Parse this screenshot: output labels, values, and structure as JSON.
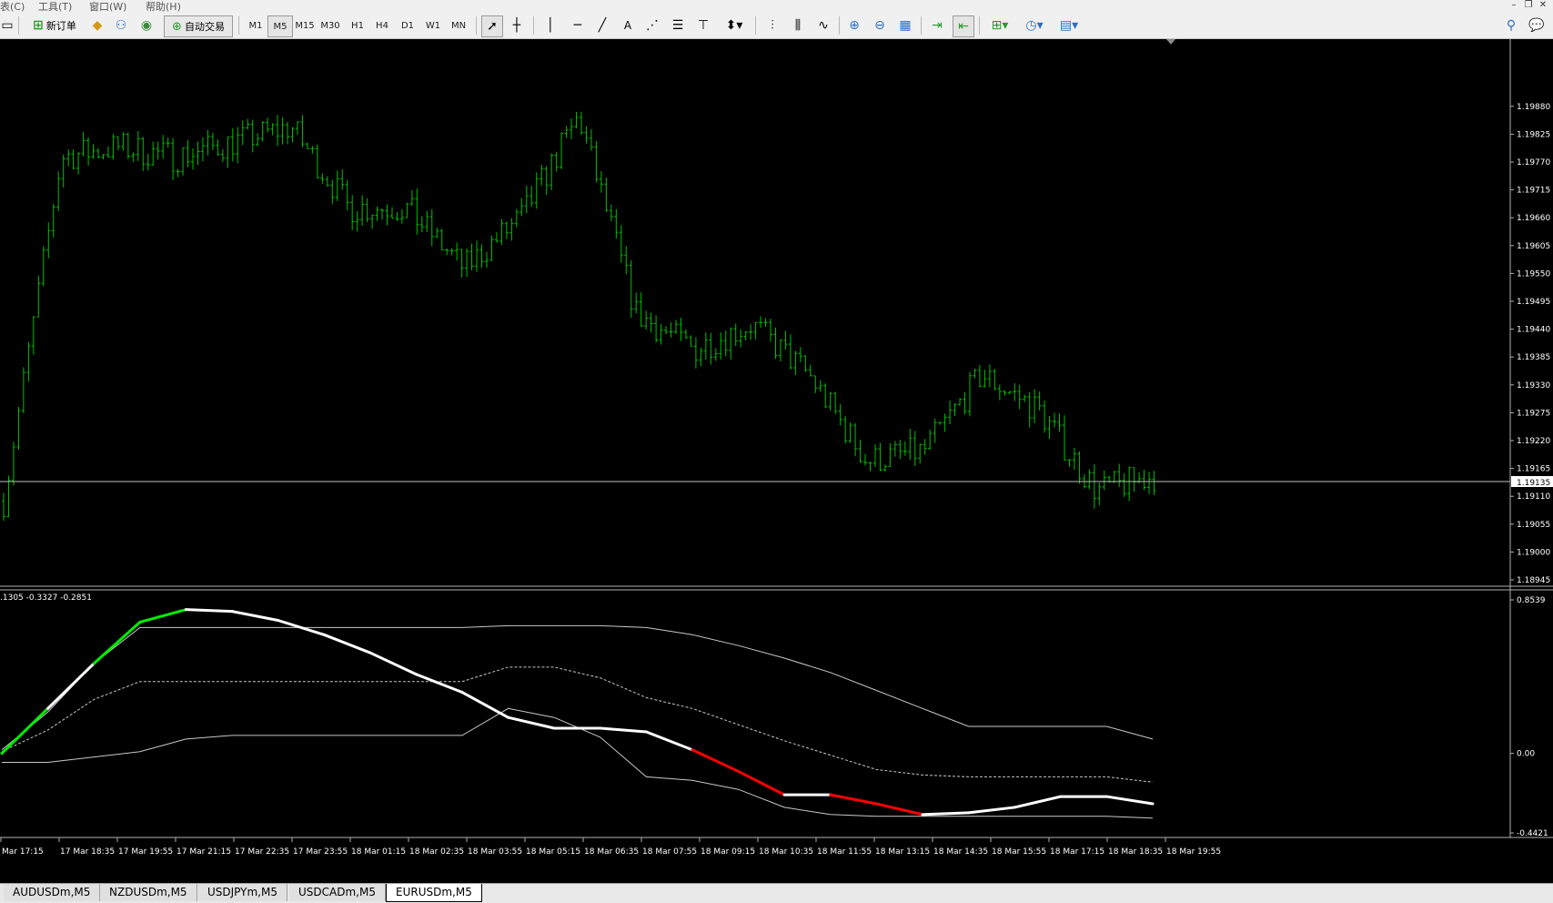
{
  "menu": {
    "items": [
      "表(C)",
      "工具(T)",
      "窗口(W)",
      "帮助(H)"
    ]
  },
  "toolbar": {
    "new_order_label": "新订单",
    "auto_trade_label": "自动交易",
    "timeframes": [
      "M1",
      "M5",
      "M15",
      "M30",
      "H1",
      "H4",
      "D1",
      "W1",
      "MN"
    ],
    "text_tool": "A"
  },
  "colors": {
    "background": "#000000",
    "price_bars": "#00c000",
    "osc_main": "#ffffff",
    "osc_up": "#00ee00",
    "osc_down": "#ff0000",
    "bands": "#c8c8c8",
    "bid_line": "#c0c0c0"
  },
  "price_axis": {
    "labels": [
      "1.19880",
      "1.19825",
      "1.19770",
      "1.19715",
      "1.19660",
      "1.19605",
      "1.19550",
      "1.19495",
      "1.19440",
      "1.19385",
      "1.19330",
      "1.19275",
      "1.19220",
      "1.19165",
      "1.19110",
      "1.19055",
      "1.19000",
      "1.18945"
    ],
    "current_price": "1.19135"
  },
  "indicator": {
    "label": ".1305 -0.3327 -0.2851",
    "axis_labels": [
      "0.8539",
      "0.00",
      "-0.4421"
    ]
  },
  "time_axis": {
    "labels": [
      "Mar 17:15",
      "17 Mar 18:35",
      "17 Mar 19:55",
      "17 Mar 21:15",
      "17 Mar 22:35",
      "17 Mar 23:55",
      "18 Mar 01:15",
      "18 Mar 02:35",
      "18 Mar 03:55",
      "18 Mar 05:15",
      "18 Mar 06:35",
      "18 Mar 07:55",
      "18 Mar 09:15",
      "18 Mar 10:35",
      "18 Mar 11:55",
      "18 Mar 13:15",
      "18 Mar 14:35",
      "18 Mar 15:55",
      "18 Mar 17:15",
      "18 Mar 18:35",
      "18 Mar 19:55"
    ]
  },
  "chart_data": {
    "type": "line",
    "symbol_timeframe": "EURUSDm,M5",
    "price_series_approx_close": [
      {
        "time": "17 Mar 17:15",
        "close": 1.191
      },
      {
        "time": "17 Mar 18:35",
        "close": 1.1978
      },
      {
        "time": "17 Mar 19:55",
        "close": 1.198
      },
      {
        "time": "17 Mar 21:15",
        "close": 1.1978
      },
      {
        "time": "17 Mar 22:35",
        "close": 1.1981
      },
      {
        "time": "17 Mar 23:55",
        "close": 1.1984
      },
      {
        "time": "18 Mar 01:15",
        "close": 1.1968
      },
      {
        "time": "18 Mar 02:35",
        "close": 1.1968
      },
      {
        "time": "18 Mar 03:55",
        "close": 1.1956
      },
      {
        "time": "18 Mar 05:15",
        "close": 1.1966
      },
      {
        "time": "18 Mar 06:35",
        "close": 1.1986
      },
      {
        "time": "18 Mar 07:55",
        "close": 1.1947
      },
      {
        "time": "18 Mar 09:15",
        "close": 1.194
      },
      {
        "time": "18 Mar 10:35",
        "close": 1.1945
      },
      {
        "time": "18 Mar 11:55",
        "close": 1.1935
      },
      {
        "time": "18 Mar 13:15",
        "close": 1.1918
      },
      {
        "time": "18 Mar 14:35",
        "close": 1.192
      },
      {
        "time": "18 Mar 15:55",
        "close": 1.1935
      },
      {
        "time": "18 Mar 17:15",
        "close": 1.1928
      },
      {
        "time": "18 Mar 18:35",
        "close": 1.1912
      },
      {
        "time": "18 Mar 19:55",
        "close": 1.1915
      }
    ],
    "price_ylim": [
      1.18945,
      1.1993
    ],
    "osc_ylim": [
      -0.4421,
      0.8539
    ],
    "oscillator": {
      "main": [
        0.0,
        0.25,
        0.5,
        0.73,
        0.8,
        0.79,
        0.74,
        0.66,
        0.56,
        0.44,
        0.34,
        0.2,
        0.14,
        0.14,
        0.12,
        0.02,
        -0.1,
        -0.23,
        -0.23,
        -0.28,
        -0.34,
        -0.33,
        -0.3,
        -0.24,
        -0.24,
        -0.28
      ],
      "upper_band": [
        0.02,
        0.23,
        0.5,
        0.7,
        0.7,
        0.7,
        0.7,
        0.7,
        0.7,
        0.7,
        0.7,
        0.71,
        0.71,
        0.71,
        0.7,
        0.66,
        0.6,
        0.53,
        0.45,
        0.35,
        0.25,
        0.15,
        0.15,
        0.15,
        0.15,
        0.08
      ],
      "middle_band": [
        0.01,
        0.13,
        0.3,
        0.4,
        0.4,
        0.4,
        0.4,
        0.4,
        0.4,
        0.4,
        0.4,
        0.48,
        0.48,
        0.42,
        0.31,
        0.25,
        0.16,
        0.07,
        -0.01,
        -0.09,
        -0.12,
        -0.13,
        -0.13,
        -0.13,
        -0.13,
        -0.16
      ],
      "lower_band": [
        -0.05,
        -0.05,
        -0.02,
        0.01,
        0.08,
        0.1,
        0.1,
        0.1,
        0.1,
        0.1,
        0.1,
        0.25,
        0.2,
        0.09,
        -0.13,
        -0.15,
        -0.2,
        -0.3,
        -0.34,
        -0.35,
        -0.35,
        -0.35,
        -0.35,
        -0.35,
        -0.35,
        -0.36
      ]
    }
  },
  "tabs": [
    {
      "label": "AUDUSDm,M5",
      "active": false
    },
    {
      "label": "NZDUSDm,M5",
      "active": false
    },
    {
      "label": "USDJPYm,M5",
      "active": false
    },
    {
      "label": "USDCADm,M5",
      "active": false
    },
    {
      "label": "EURUSDm,M5",
      "active": true
    }
  ]
}
